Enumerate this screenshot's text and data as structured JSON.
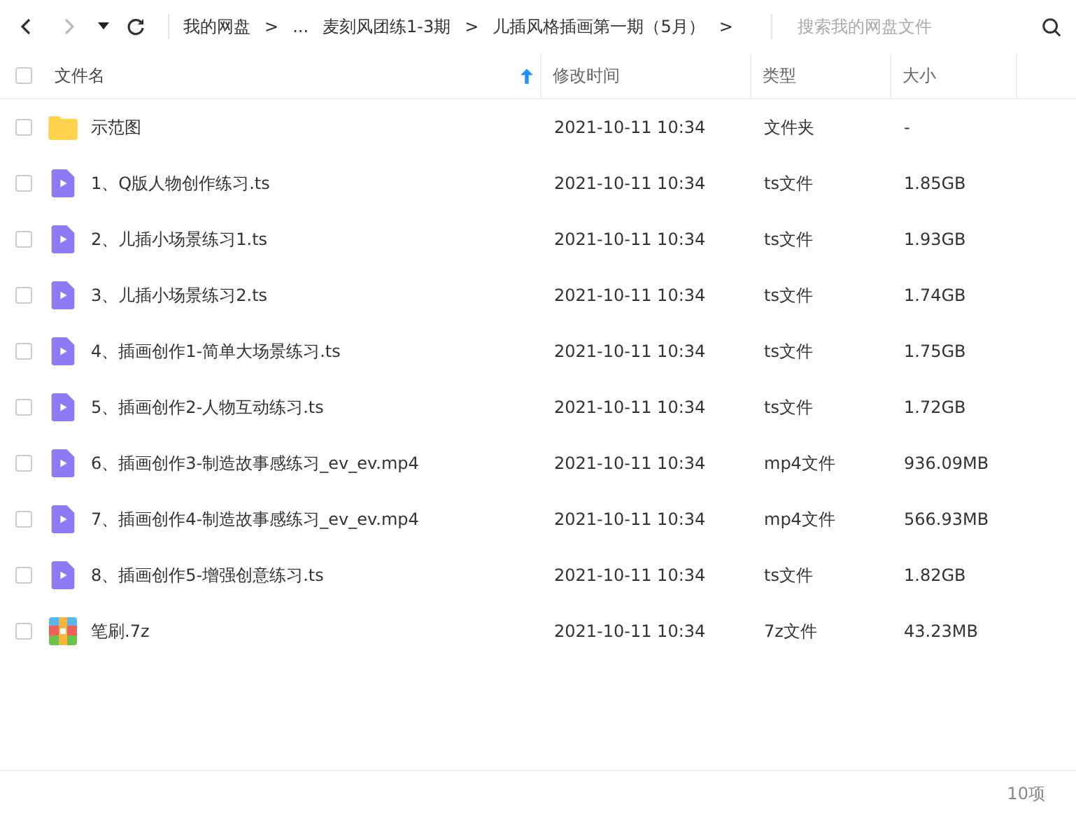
{
  "toolbar": {
    "breadcrumbs": [
      {
        "label": "我的网盘",
        "separator": ">"
      },
      {
        "label": "..."
      },
      {
        "label": "麦刻风团练1-3期",
        "separator": ">"
      },
      {
        "label": "儿插风格插画第一期（5月）",
        "separator": ">"
      }
    ],
    "search": {
      "placeholder": "搜索我的网盘文件"
    }
  },
  "table": {
    "all_checked": false,
    "columns": [
      {
        "label": "文件名",
        "sorted": true
      },
      {
        "label": "修改时间",
        "sorted": false
      },
      {
        "label": "类型",
        "sorted": false
      },
      {
        "label": "大小",
        "sorted": false
      }
    ],
    "rows": [
      {
        "kind": "folder",
        "name": "示范图",
        "modified": "2021-10-11 10:34",
        "type": "文件夹",
        "size": "-",
        "checked": false
      },
      {
        "kind": "video",
        "name": "1、Q版人物创作练习.ts",
        "modified": "2021-10-11 10:34",
        "type": "ts文件",
        "size": "1.85GB",
        "checked": false
      },
      {
        "kind": "video",
        "name": "2、儿插小场景练习1.ts",
        "modified": "2021-10-11 10:34",
        "type": "ts文件",
        "size": "1.93GB",
        "checked": false
      },
      {
        "kind": "video",
        "name": "3、儿插小场景练习2.ts",
        "modified": "2021-10-11 10:34",
        "type": "ts文件",
        "size": "1.74GB",
        "checked": false
      },
      {
        "kind": "video",
        "name": "4、插画创作1-简单大场景练习.ts",
        "modified": "2021-10-11 10:34",
        "type": "ts文件",
        "size": "1.75GB",
        "checked": false
      },
      {
        "kind": "video",
        "name": "5、插画创作2-人物互动练习.ts",
        "modified": "2021-10-11 10:34",
        "type": "ts文件",
        "size": "1.72GB",
        "checked": false
      },
      {
        "kind": "video",
        "name": "6、插画创作3-制造故事感练习_ev_ev.mp4",
        "modified": "2021-10-11 10:34",
        "type": "mp4文件",
        "size": "936.09MB",
        "checked": false
      },
      {
        "kind": "video",
        "name": "7、插画创作4-制造故事感练习_ev_ev.mp4",
        "modified": "2021-10-11 10:34",
        "type": "mp4文件",
        "size": "566.93MB",
        "checked": false
      },
      {
        "kind": "video",
        "name": "8、插画创作5-增强创意练习.ts",
        "modified": "2021-10-11 10:34",
        "type": "ts文件",
        "size": "1.82GB",
        "checked": false
      },
      {
        "kind": "archive",
        "name": "笔刷.7z",
        "modified": "2021-10-11 10:34",
        "type": "7z文件",
        "size": "43.23MB",
        "checked": false
      }
    ]
  },
  "status_bar": {
    "count": "10项"
  }
}
